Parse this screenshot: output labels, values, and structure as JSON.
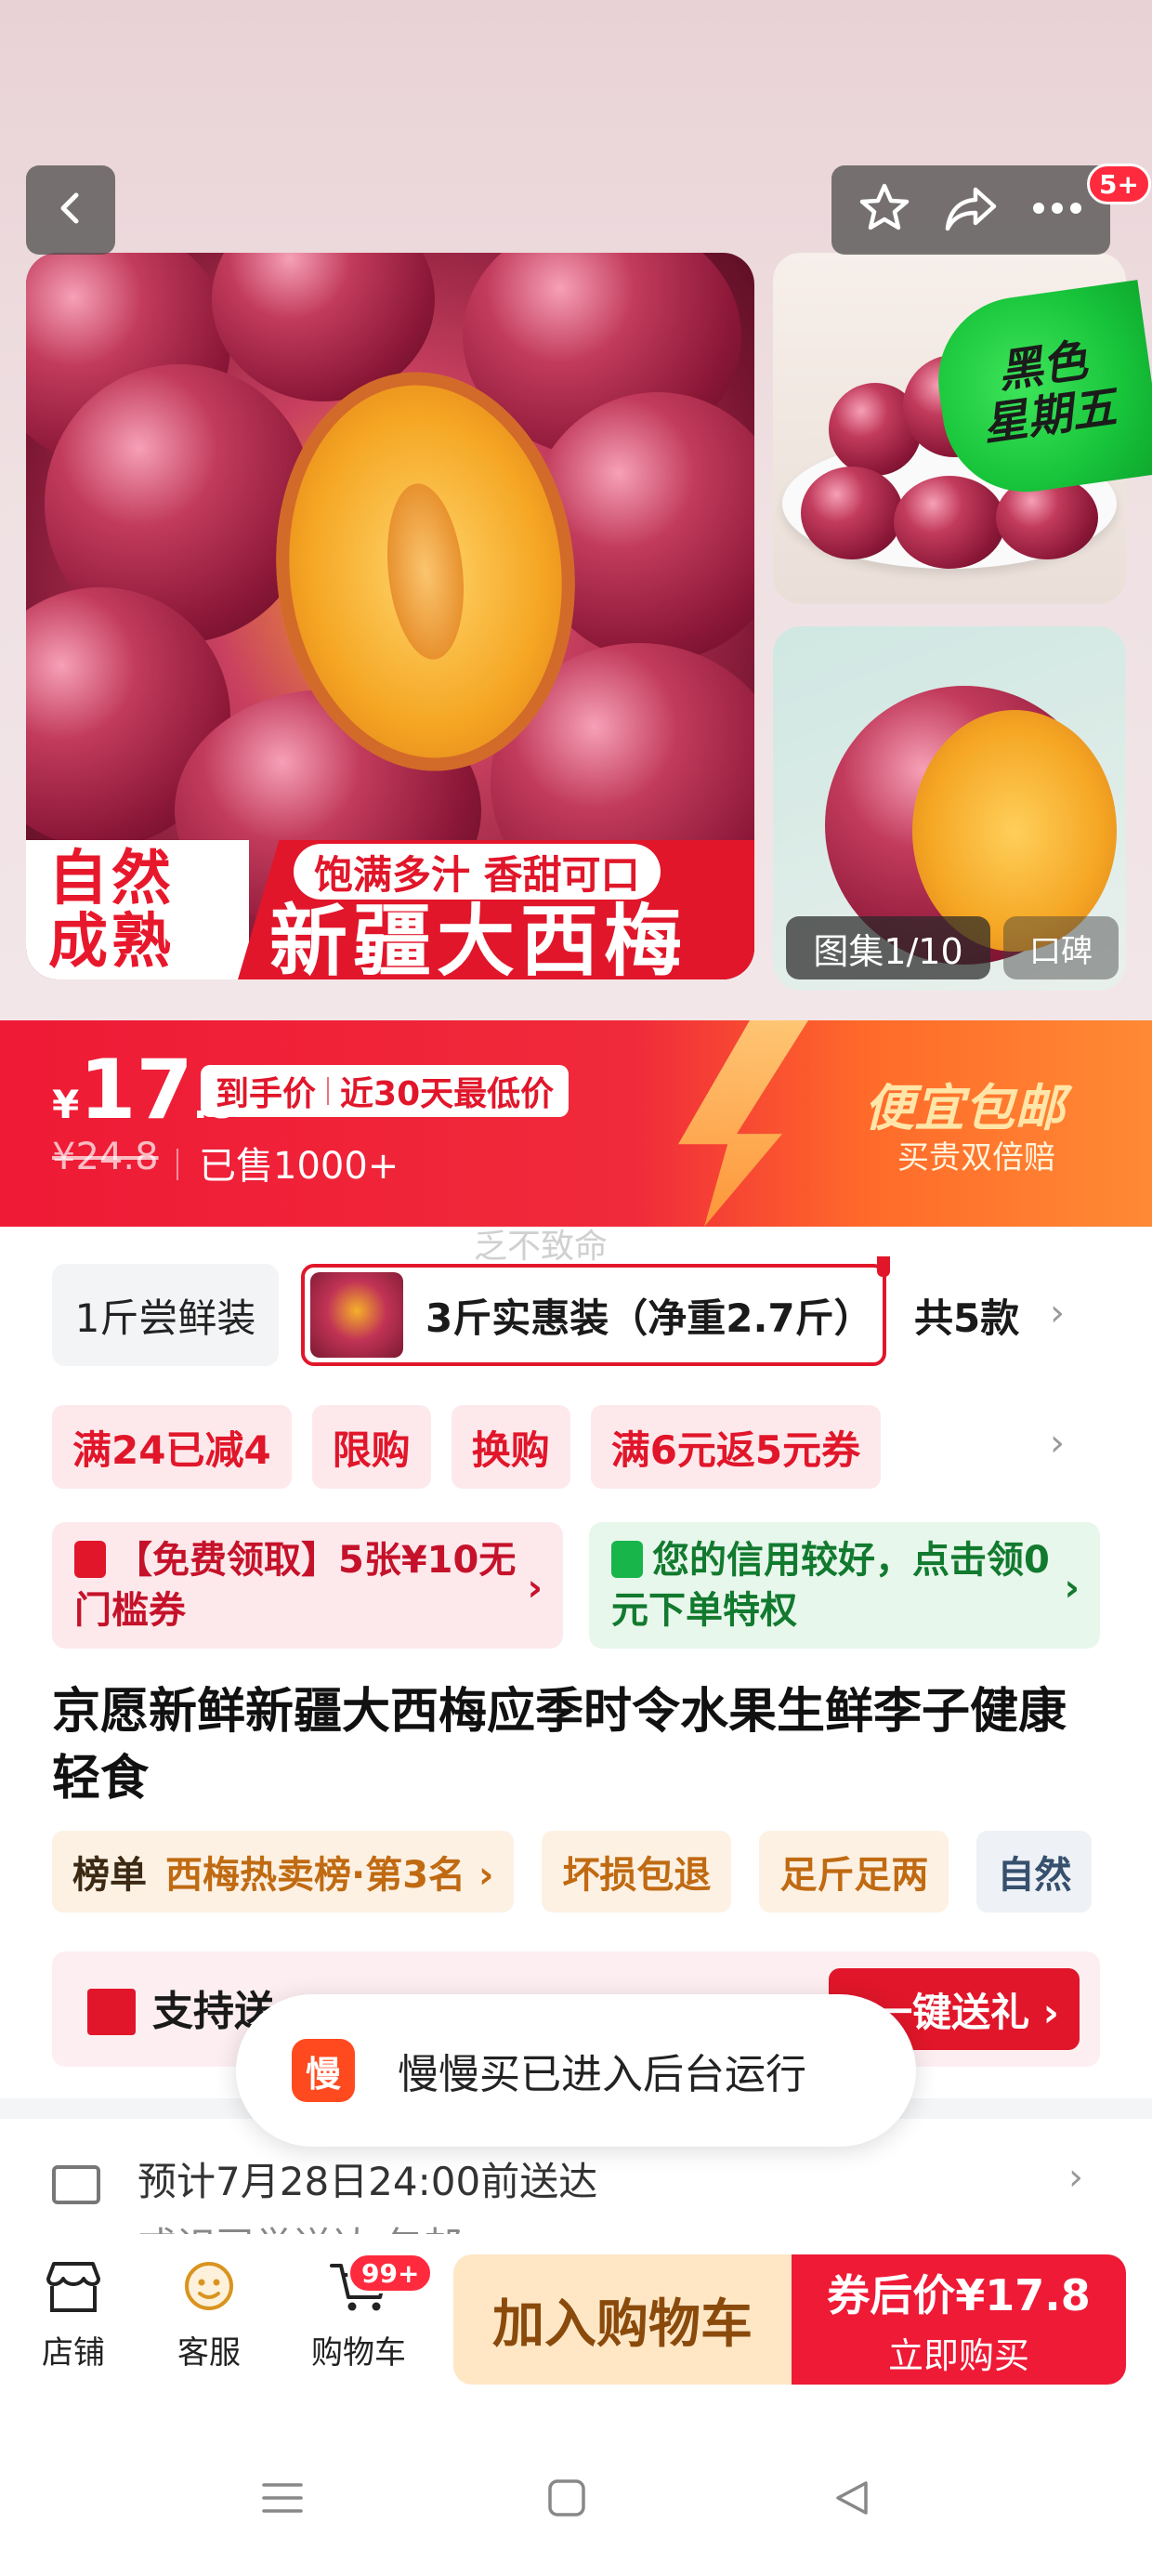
{
  "top_actions": {
    "back": "back-icon",
    "favorite": "star-icon",
    "share": "share-icon",
    "more": "more-icon",
    "message_badge": "5+"
  },
  "gallery": {
    "main_banner_left": "自然\n成熟",
    "main_banner_tag": "饱满多汁 香甜可口",
    "main_banner_title": "新疆大西梅",
    "promo_tag_line1": "黑色",
    "promo_tag_line2": "星期五",
    "count_label": "图集1/10",
    "extra_label": "口碑"
  },
  "price": {
    "currency": "¥",
    "integer": "17",
    "decimal": ".8",
    "tag_part1": "到手价",
    "tag_part2": "近30天最低价",
    "original": "¥24.8",
    "sold": "已售1000+",
    "promo_title": "便宜包邮",
    "promo_sub": "买贵双倍赔",
    "accent": "#ef1a36"
  },
  "watermark": "乏不致命",
  "variants": {
    "option_a": "1斤尝鲜装",
    "option_b": "3斤实惠装（净重2.7斤）",
    "count": "共5款"
  },
  "promotions": [
    "满24已减4",
    "限购",
    "换购",
    "满6元返5元券"
  ],
  "coupons": {
    "red_text": "【免费领取】5张¥10无门槛券",
    "red_icon": "coupon-icon",
    "green_text": "您的信用较好，点击领0元下单特权",
    "green_icon": "bag-icon"
  },
  "product_title": "京愿新鲜新疆大西梅应季时令水果生鲜李子健康轻食",
  "tags": {
    "rank_label": "榜单",
    "rank_value": "西梅热卖榜·第3名 ›",
    "items": [
      "坏损包退",
      "足斤足两",
      "自然"
    ]
  },
  "gift": {
    "label": "支持送",
    "button": "一键送礼 ›"
  },
  "toast": {
    "app_icon_text": "慢",
    "message": "慢慢买已进入后台运行"
  },
  "delivery": {
    "line1": "预计7月28日24:00前送达",
    "line2": "或识司举送达 包邮"
  },
  "bottom_bar": {
    "store": "店铺",
    "service": "客服",
    "cart": "购物车",
    "cart_badge": "99+",
    "add_to_cart": "加入购物车",
    "buy_line1": "券后价¥17.8",
    "buy_line2": "立即购买"
  },
  "system_nav": {
    "menu": "menu-icon",
    "home": "home-icon",
    "back": "back-triangle-icon"
  }
}
